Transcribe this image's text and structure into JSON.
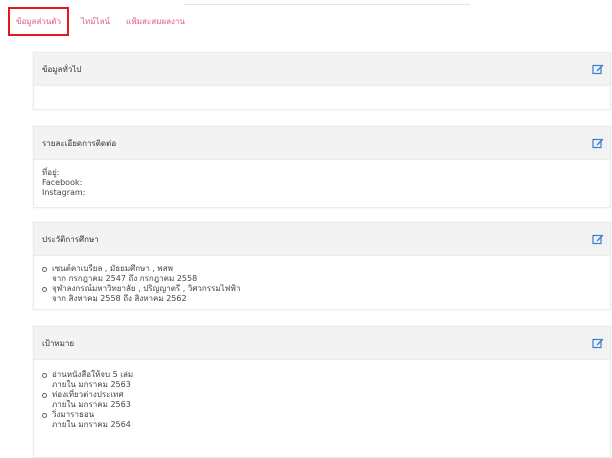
{
  "tabs": [
    {
      "label": "ข้อมูลส่วนตัว",
      "active": true
    },
    {
      "label": "ไทม์ไลน์",
      "active": false
    },
    {
      "label": "แฟ้มสะสมผลงาน",
      "active": false
    }
  ],
  "cards": {
    "general": {
      "title": "ข้อมูลทั่วไป",
      "icon": "edit-icon"
    },
    "contact": {
      "title": "รายละเอียดการติดต่อ",
      "icon": "edit-icon",
      "lines": [
        "ที่อยู่:",
        "Facebook:",
        "Instagram:"
      ]
    },
    "education": {
      "title": "ประวัติการศึกษา",
      "icon": "edit-icon",
      "items": [
        {
          "line1": "เซนต์คาเบรียล , มัธยมศึกษา , พสพ",
          "line2": "จาก กรกฎาคม 2547 ถึง กรกฎาคม 2558"
        },
        {
          "line1": "จุฬาลงกรณ์มหาวิทยาลัย , ปริญญาตรี , วิศวกรรมไฟฟ้า",
          "line2": "จาก สิงหาคม 2558 ถึง สิงหาคม 2562"
        }
      ]
    },
    "goals": {
      "title": "เป้าหมาย",
      "icon": "edit-icon",
      "items": [
        {
          "line1": "อ่านหนังสือให้จบ 5 เล่ม",
          "line2": "ภายใน มกราคม 2563"
        },
        {
          "line1": "ท่องเที่ยวต่างประเทศ",
          "line2": "ภายใน มกราคม 2563"
        },
        {
          "line1": "วิ่งมาราธอน",
          "line2": "ภายใน มกราคม 2564"
        }
      ]
    }
  },
  "colors": {
    "tab_text": "#e05a8a",
    "active_border": "#e0191f",
    "header_bg": "#f3f3f3",
    "icon": "#3a7bd5"
  }
}
